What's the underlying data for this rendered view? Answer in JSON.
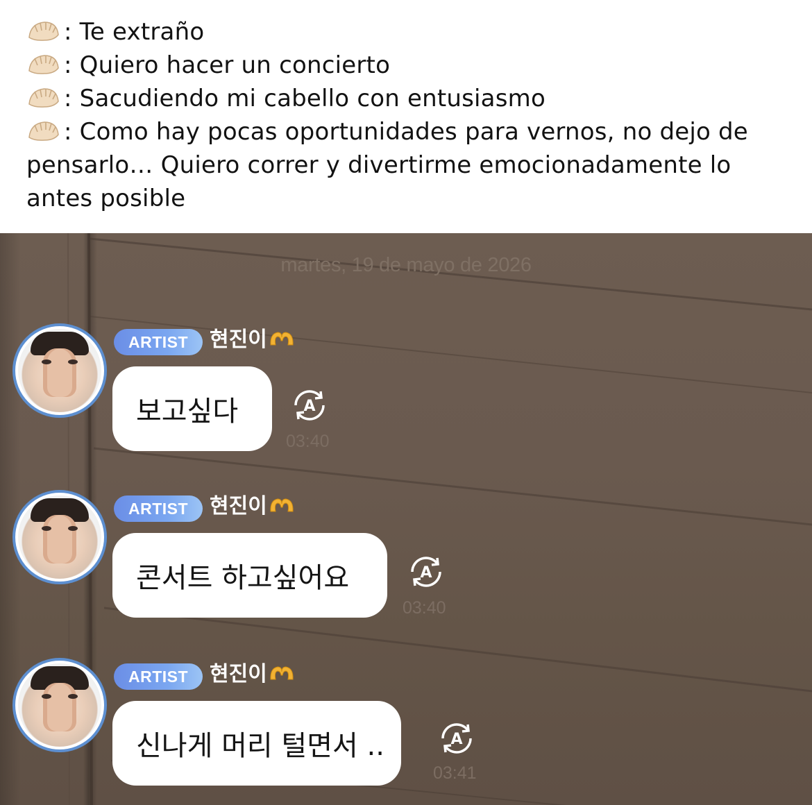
{
  "caption": {
    "lines": [
      ": Te extraño",
      ": Quiero hacer un concierto",
      ": Sacudiendo mi cabello con entusiasmo",
      ": Como hay pocas oportunidades para vernos, no dejo de pensarlo… Quiero correr y divertirme emocionadamente lo antes posible"
    ],
    "icon": "dumpling-emoji"
  },
  "chat": {
    "date": "martes, 19 de mayo de 2026",
    "messages": [
      {
        "badge": "ARTIST",
        "author": "현진이",
        "author_icon": "heart-hands-emoji",
        "text": "보고싶다",
        "time": "03:40",
        "action_icon": "auto-translate-icon"
      },
      {
        "badge": "ARTIST",
        "author": "현진이",
        "author_icon": "heart-hands-emoji",
        "text": "콘서트 하고싶어요",
        "time": "03:40",
        "action_icon": "auto-translate-icon"
      },
      {
        "badge": "ARTIST",
        "author": "현진이",
        "author_icon": "heart-hands-emoji",
        "text": "신나게 머리 털면서 ..",
        "time": "03:41",
        "action_icon": "auto-translate-icon"
      }
    ]
  },
  "colors": {
    "badge_blue": "#6b8ee6",
    "avatar_ring": "#5d8fd0",
    "wood": "#6a5a4f",
    "bubble": "#ffffff"
  }
}
